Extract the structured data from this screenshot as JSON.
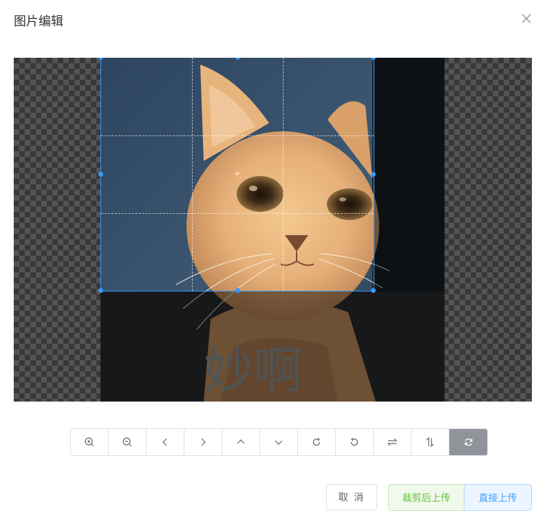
{
  "dialog": {
    "title": "图片编辑",
    "close_icon": "close-icon"
  },
  "editor": {
    "image_alt": "猫咪图片",
    "overlay_text": "妙啊"
  },
  "toolbar": {
    "buttons": [
      {
        "name": "zoom-in",
        "icon": "zoom-in-icon"
      },
      {
        "name": "zoom-out",
        "icon": "zoom-out-icon"
      },
      {
        "name": "move-left",
        "icon": "chevron-left-icon"
      },
      {
        "name": "move-right",
        "icon": "chevron-right-icon"
      },
      {
        "name": "move-up",
        "icon": "chevron-up-icon"
      },
      {
        "name": "move-down",
        "icon": "chevron-down-icon"
      },
      {
        "name": "rotate-right",
        "icon": "rotate-clockwise-icon"
      },
      {
        "name": "rotate-left",
        "icon": "rotate-counterclockwise-icon"
      },
      {
        "name": "flip-horizontal",
        "icon": "flip-horizontal-icon"
      },
      {
        "name": "flip-vertical",
        "icon": "flip-vertical-icon"
      },
      {
        "name": "reset",
        "icon": "refresh-icon",
        "active": true
      }
    ]
  },
  "footer": {
    "cancel_label": "取 消",
    "crop_upload_label": "裁剪后上传",
    "direct_upload_label": "直接上传"
  },
  "colors": {
    "crop_outline": "#3399ff",
    "success": "#67c23a",
    "primary": "#409eff",
    "active_tool": "#909399"
  }
}
